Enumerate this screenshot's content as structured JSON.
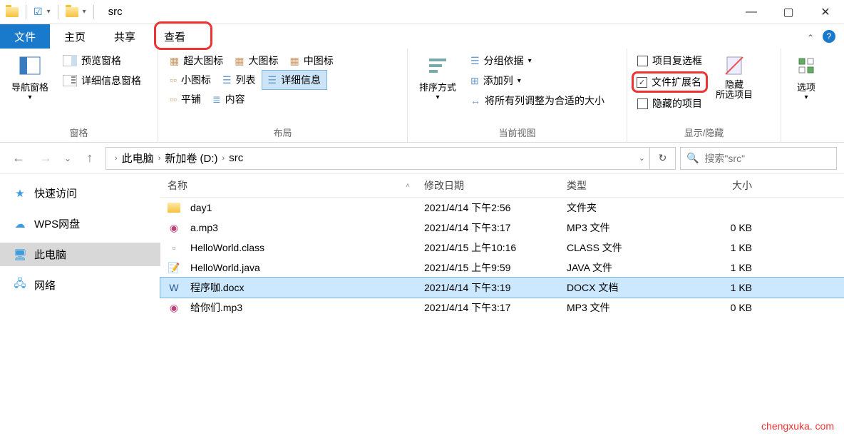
{
  "title": "src",
  "tabs": {
    "file": "文件",
    "home": "主页",
    "share": "共享",
    "view": "查看"
  },
  "ribbon": {
    "panes": {
      "nav_pane": "导航窗格",
      "preview": "预览窗格",
      "details": "详细信息窗格",
      "group_label": "窗格"
    },
    "layout": {
      "extra_large": "超大图标",
      "large": "大图标",
      "medium": "中图标",
      "small": "小图标",
      "list": "列表",
      "details": "详细信息",
      "tiles": "平铺",
      "content": "内容",
      "group_label": "布局"
    },
    "current_view": {
      "sort": "排序方式",
      "group_by": "分组依据",
      "add_columns": "添加列",
      "size_columns": "将所有列调整为合适的大小",
      "group_label": "当前视图"
    },
    "show_hide": {
      "item_checkbox": "项目复选框",
      "file_ext": "文件扩展名",
      "hidden_items": "隐藏的项目",
      "hide_selected": "隐藏\n所选项目",
      "group_label": "显示/隐藏"
    },
    "options": "选项"
  },
  "breadcrumb": {
    "this_pc": "此电脑",
    "volume": "新加卷 (D:)",
    "folder": "src"
  },
  "search_placeholder": "搜索\"src\"",
  "sidebar": {
    "quick_access": "快速访问",
    "wps": "WPS网盘",
    "this_pc": "此电脑",
    "network": "网络"
  },
  "columns": {
    "name": "名称",
    "modified": "修改日期",
    "type": "类型",
    "size": "大小"
  },
  "files": [
    {
      "name": "day1",
      "modified": "2021/4/14 下午2:56",
      "type": "文件夹",
      "size": "",
      "icon": "folder"
    },
    {
      "name": "a.mp3",
      "modified": "2021/4/14 下午3:17",
      "type": "MP3 文件",
      "size": "0 KB",
      "icon": "mp3"
    },
    {
      "name": "HelloWorld.class",
      "modified": "2021/4/15 上午10:16",
      "type": "CLASS 文件",
      "size": "1 KB",
      "icon": "file"
    },
    {
      "name": "HelloWorld.java",
      "modified": "2021/4/15 上午9:59",
      "type": "JAVA 文件",
      "size": "1 KB",
      "icon": "java"
    },
    {
      "name": "程序咖.docx",
      "modified": "2021/4/14 下午3:19",
      "type": "DOCX 文档",
      "size": "1 KB",
      "icon": "docx"
    },
    {
      "name": "给你们.mp3",
      "modified": "2021/4/14 下午3:17",
      "type": "MP3 文件",
      "size": "0 KB",
      "icon": "mp3"
    }
  ],
  "selected_index": 4,
  "watermark": "chengxuka. com"
}
